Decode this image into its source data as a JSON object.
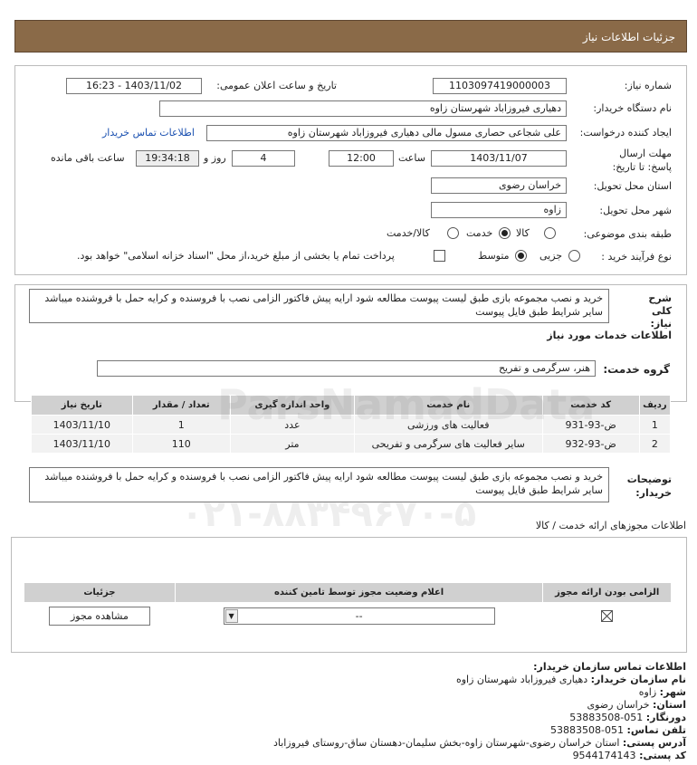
{
  "header": {
    "title": "جزئیات اطلاعات نیاز"
  },
  "details": {
    "need_number_label": "شماره نیاز:",
    "need_number": "1103097419000003",
    "announce_label": "تاریخ و ساعت اعلان عمومی:",
    "announce_value": "1403/11/02 - 16:23",
    "buyer_org_label": "نام دستگاه خریدار:",
    "buyer_org": "دهیاری فیروزاباد شهرستان زاوه",
    "creator_label": "ایجاد کننده درخواست:",
    "creator": "علی شجاعی حصاری مسول مالی دهیاری فیروزاباد شهرستان زاوه",
    "contact_link": "اطلاعات تماس خریدار",
    "deadline_label": "مهلت ارسال پاسخ: تا تاریخ:",
    "deadline_date": "1403/11/07",
    "time_label": "ساعت",
    "deadline_time": "12:00",
    "days_value": "4",
    "days_label": "روز و",
    "remaining_time": "19:34:18",
    "remaining_label": "ساعت باقی مانده",
    "province_label": "استان محل تحویل:",
    "province": "خراسان رضوی",
    "city_label": "شهر محل تحویل:",
    "city": "زاوه",
    "category_label": "طبقه بندی موضوعی:",
    "category_options": [
      "کالا",
      "خدمت",
      "کالا/خدمت"
    ],
    "category_selected": "خدمت",
    "process_label": "نوع فرآیند خرید :",
    "process_options": [
      "جزیی",
      "متوسط"
    ],
    "process_selected": "متوسط",
    "payment_note": "پرداخت تمام یا بخشی از مبلغ خرید،از محل \"اسناد خزانه اسلامی\" خواهد بود."
  },
  "summary": {
    "label": "شرح کلی نیاز:",
    "text": "خرید و نصب مجموعه بازی طبق لیست پیوست مطالعه شود ارایه پیش فاکتور الزامی نصب با فروسنده و کرایه حمل با فروشنده میباشد سایر شرایط طبق فایل پیوست"
  },
  "services": {
    "section_title": "اطلاعات خدمات مورد نیاز",
    "group_label": "گروه خدمت:",
    "group_value": "هنر، سرگرمی و تفریح",
    "columns": [
      "ردیف",
      "کد خدمت",
      "نام خدمت",
      "واحد اندازه گیری",
      "تعداد / مقدار",
      "تاریخ نیاز"
    ],
    "rows": [
      [
        "1",
        "ض-93-931",
        "فعالیت های ورزشی",
        "عدد",
        "1",
        "1403/11/10"
      ],
      [
        "2",
        "ض-93-932",
        "سایر فعالیت های سرگرمی و تفریحی",
        "متر",
        "110",
        "1403/11/10"
      ]
    ],
    "buyer_notes_label": "توضیحات خریدار:",
    "buyer_notes": "خرید و نصب مجموعه بازی طبق لیست پیوست مطالعه شود ارایه پیش فاکتور الزامی نصب با فروسنده و کرایه حمل با فروشنده میباشد سایر شرایط طبق فایل پیوست"
  },
  "permits": {
    "section_title": "اطلاعات مجوزهای ارائه خدمت / کالا",
    "columns": [
      "الزامی بودن ارائه مجوز",
      "اعلام وضعیت مجوز توسط تامین کننده",
      "جزئیات"
    ],
    "select_value": "--",
    "view_button": "مشاهده مجوز"
  },
  "contact": {
    "title": "اطلاعات تماس سازمان خریدار:",
    "org_label": "نام سازمان خریدار:",
    "org": "دهیاری فیروزاباد شهرستان زاوه",
    "city_label": "شهر:",
    "city": "زاوه",
    "province_label": "استان:",
    "province": "خراسان رضوی",
    "fax_label": "دورنگار:",
    "fax": "051-53883508",
    "phone_label": "تلفن تماس:",
    "phone": "051-53883508",
    "address_label": "آدرس پستی:",
    "address": "استان خراسان رضوی-شهرستان زاوه-بخش سلیمان-دهستان ساق-روستای فیروزاباد",
    "postal_label": "کد پستی:",
    "postal": "9544174143"
  },
  "watermark": {
    "phone": "۰۲۱-۸۸۳۴۹۶۷۰-۵",
    "brand": "ParsNamadData"
  }
}
